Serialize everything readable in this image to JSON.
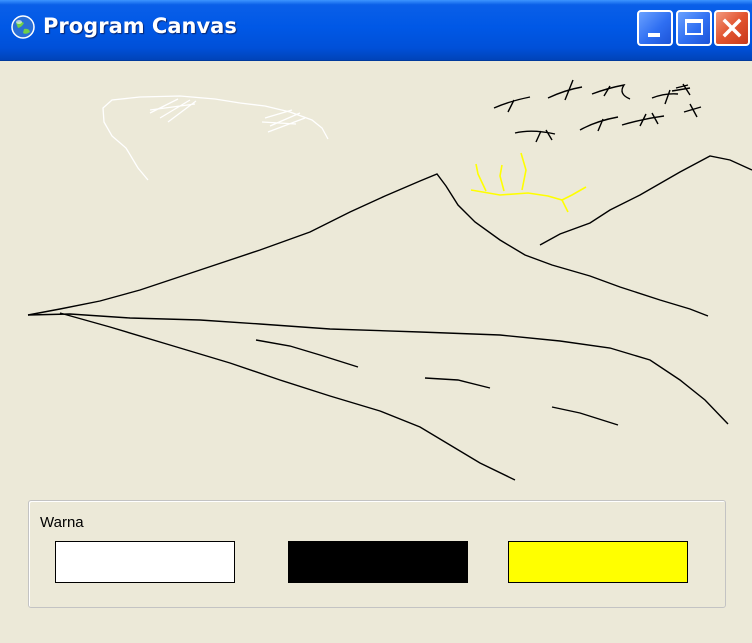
{
  "window": {
    "title": "Program Canvas",
    "icon": "globe-icon",
    "controls": [
      "minimize-icon",
      "maximize-icon",
      "close-icon"
    ]
  },
  "canvas": {
    "background": "#ece9d8",
    "strokes": {
      "black": "#000000",
      "white": "#ffffff",
      "yellow": "#ffff00"
    }
  },
  "palette": {
    "label": "Warna",
    "colors": [
      {
        "name": "white",
        "hex": "#ffffff"
      },
      {
        "name": "black",
        "hex": "#000000"
      },
      {
        "name": "yellow",
        "hex": "#ffff00"
      }
    ]
  }
}
